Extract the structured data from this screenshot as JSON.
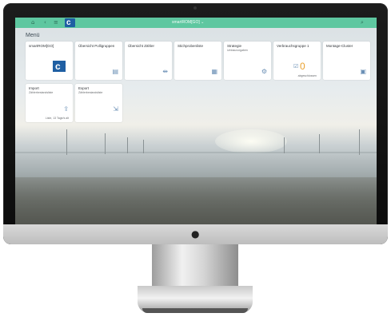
{
  "topbar": {
    "title": "smartROM[GO] ⌄",
    "home_icon": "home-icon",
    "back_icon": "back-icon",
    "menu_icon": "menu-icon",
    "search_icon": "search-icon",
    "accent": "#5ec7a0"
  },
  "menu": {
    "title": "Menü"
  },
  "tiles": [
    {
      "title": "smartROM[GO]",
      "subtitle": "",
      "icon": "company-logo"
    },
    {
      "title": "Übersicht Polligruppen",
      "subtitle": "",
      "icon": "table-icon"
    },
    {
      "title": "Übersicht Zähler",
      "subtitle": "",
      "icon": "meters-icon"
    },
    {
      "title": "Stichprobenliste",
      "subtitle": "",
      "icon": "calendar-icon"
    },
    {
      "title": "Strategie",
      "subtitle": "Umbauvorgaben",
      "icon": "settings-icon"
    },
    {
      "title": "Verbrauchsgruppe 1",
      "subtitle": "",
      "icon": "check-icon",
      "value": "0",
      "footer": "abgeschlossen"
    },
    {
      "title": "Montage-Cluster",
      "subtitle": "",
      "icon": "cluster-icon"
    },
    {
      "title": "Import",
      "subtitle": "Zählerbestandsliste",
      "icon": "upload-icon",
      "footer": "Liste, 13 Tage/s alt"
    },
    {
      "title": "Export",
      "subtitle": "Zählerbestandsliste",
      "icon": "export-icon"
    }
  ]
}
